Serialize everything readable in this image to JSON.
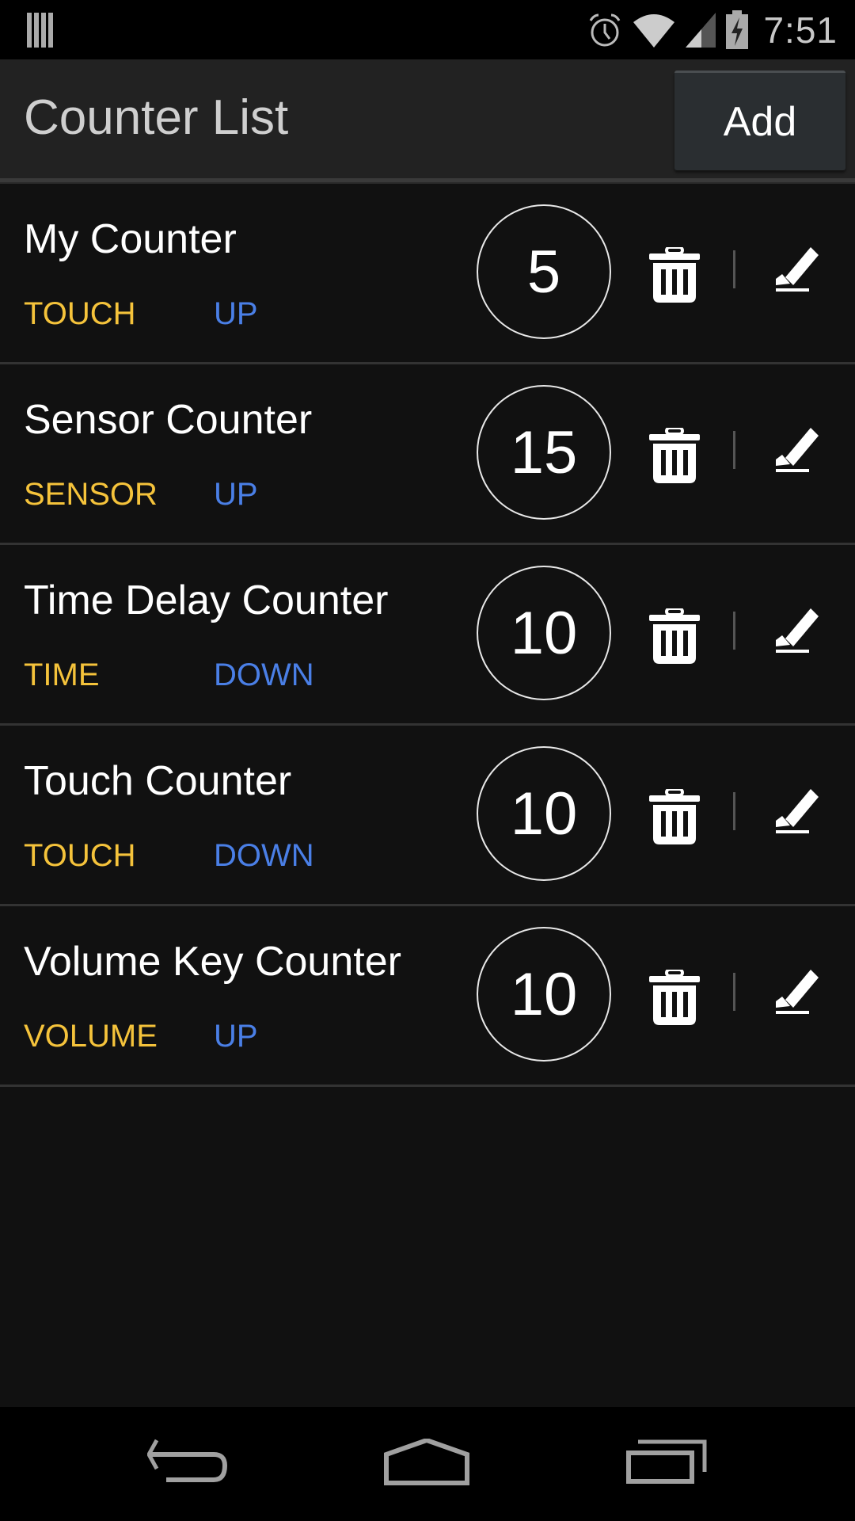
{
  "status_bar": {
    "time": "7:51",
    "icons": [
      "notification-stack-icon",
      "alarm-icon",
      "wifi-icon",
      "signal-icon",
      "battery-charging-icon"
    ]
  },
  "action_bar": {
    "title": "Counter List",
    "add_label": "Add"
  },
  "counters": [
    {
      "name": "My Counter",
      "type": "TOUCH",
      "direction": "UP",
      "count": "5"
    },
    {
      "name": "Sensor Counter",
      "type": "SENSOR",
      "direction": "UP",
      "count": "15"
    },
    {
      "name": "Time Delay Counter",
      "type": "TIME",
      "direction": "DOWN",
      "count": "10"
    },
    {
      "name": "Touch Counter",
      "type": "TOUCH",
      "direction": "DOWN",
      "count": "10"
    },
    {
      "name": "Volume Key Counter",
      "type": "VOLUME",
      "direction": "UP",
      "count": "10"
    }
  ],
  "row_icons": {
    "delete": "trash-icon",
    "edit": "pencil-icon"
  },
  "nav_bar": {
    "buttons": [
      "back",
      "home",
      "recents"
    ]
  },
  "colors": {
    "type": "#f5c33b",
    "direction": "#4a7fe6",
    "background": "#111111",
    "action_bar": "#222222"
  }
}
